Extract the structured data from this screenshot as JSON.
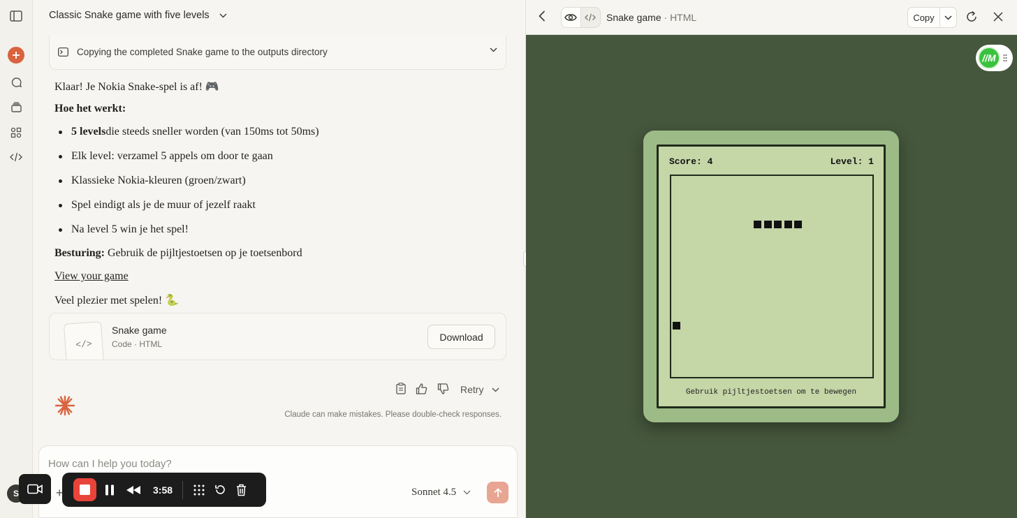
{
  "chat": {
    "title": "Classic Snake game with five levels",
    "tool_status": "Copying the completed Snake game to the outputs directory",
    "intro": "Klaar! Je Nokia Snake-spel is af! 🎮",
    "how_heading": "Hoe het werkt:",
    "bullets": [
      {
        "bold": "5 levels",
        "text": " die steeds sneller worden (van 150ms tot 50ms)"
      },
      {
        "bold": "",
        "text": "Elk level: verzamel 5 appels om door te gaan"
      },
      {
        "bold": "",
        "text": "Klassieke Nokia-kleuren (groen/zwart)"
      },
      {
        "bold": "",
        "text": "Spel eindigt als je de muur of jezelf raakt"
      },
      {
        "bold": "",
        "text": "Na level 5 win je het spel!"
      }
    ],
    "controls_label": "Besturing:",
    "controls_text": " Gebruik de pijltjestoetsen op je toetsenbord",
    "view_link": "View your game",
    "outro": "Veel plezier met spelen! 🐍",
    "artifact_title": "Snake game",
    "artifact_sub": "Code · HTML",
    "download_label": "Download",
    "retry_label": "Retry",
    "disclaimer": "Claude can make mistakes. Please double-check responses.",
    "composer_placeholder": "How can I help you today?",
    "model": "Sonnet 4.5",
    "avatar_initial": "S"
  },
  "recorder": {
    "time": "3:58"
  },
  "artifact_panel": {
    "name": "Snake game",
    "kind": "HTML",
    "copy_label": "Copy",
    "extension_badge": "//M"
  },
  "game": {
    "score_label": "Score: 4",
    "level_label": "Level: 1",
    "hint": "Gebruik pijltjestoetsen om te bewegen",
    "snake_cells": [
      [
        8,
        4
      ],
      [
        9,
        4
      ],
      [
        10,
        4
      ],
      [
        11,
        4
      ],
      [
        12,
        4
      ]
    ],
    "apple_cell": [
      0,
      14
    ]
  },
  "colors": {
    "accent": "#d9623f",
    "stage_bg": "#45573d",
    "device_bg": "#9cbb86",
    "screen_bg": "#c5d6a7",
    "record_red": "#e9443a"
  }
}
